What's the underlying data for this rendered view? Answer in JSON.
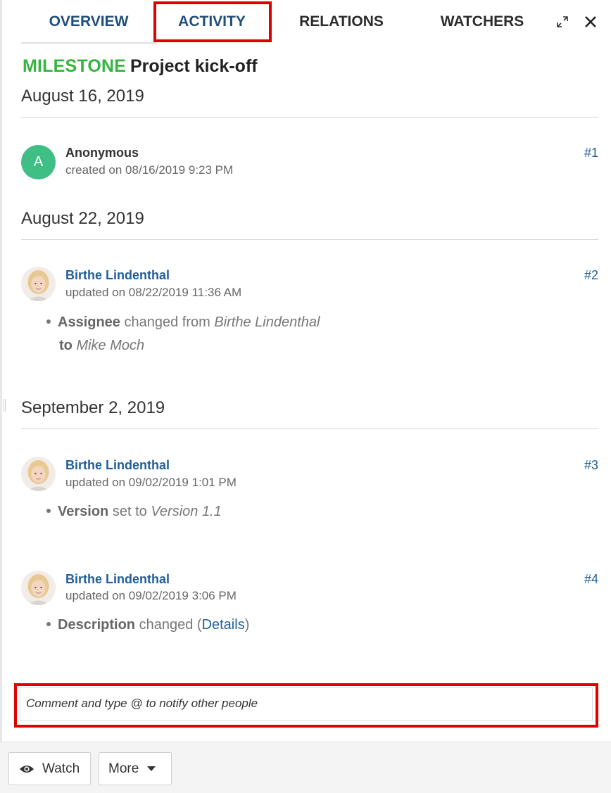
{
  "tabs": {
    "overview": "OVERVIEW",
    "activity": "ACTIVITY",
    "relations": "RELATIONS",
    "watchers": "WATCHERS"
  },
  "work_package": {
    "type": "MILESTONE",
    "subject": "Project kick-off"
  },
  "activity_groups": [
    {
      "date": "August 16, 2019",
      "entries": [
        {
          "user": "Anonymous",
          "avatar_initial": "A",
          "meta": "created on 08/16/2019 9:23 PM",
          "number": "#1"
        }
      ]
    },
    {
      "date": "August 22, 2019",
      "entries": [
        {
          "user": "Birthe Lindenthal",
          "meta": "updated on 08/22/2019 11:36 AM",
          "number": "#2",
          "change": {
            "field": "Assignee",
            "text1": "changed from",
            "from": "Birthe Lindenthal",
            "to_label": "to",
            "to": "Mike Moch"
          }
        }
      ]
    },
    {
      "date": "September 2, 2019",
      "entries": [
        {
          "user": "Birthe Lindenthal",
          "meta": "updated on 09/02/2019 1:01 PM",
          "number": "#3",
          "change": {
            "field": "Version",
            "text": "set to",
            "value": "Version 1.1"
          }
        },
        {
          "user": "Birthe Lindenthal",
          "meta": "updated on 09/02/2019 3:06 PM",
          "number": "#4",
          "change": {
            "field": "Description",
            "text": "changed (",
            "link": "Details",
            "close": ")"
          }
        }
      ]
    }
  ],
  "comment": {
    "placeholder": "Comment and type @ to notify other people"
  },
  "footer": {
    "watch_label": "Watch",
    "more_label": "More"
  },
  "icons": {
    "expand": "expand-icon",
    "close": "close-icon",
    "watch": "eye-icon",
    "more": "caret-down-icon"
  },
  "colors": {
    "tab_active": "#1f4e79",
    "milestone": "#35b53f",
    "link": "#1f5e99",
    "highlight": "#e00000",
    "anon_avatar": "#3fbf86"
  }
}
